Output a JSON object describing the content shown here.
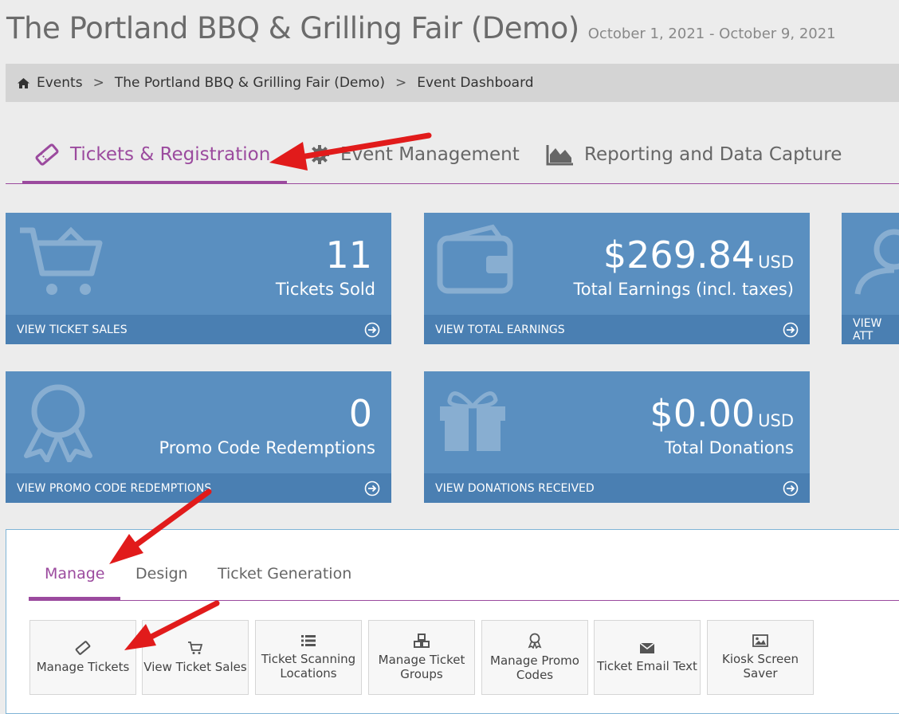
{
  "header": {
    "title": "The Portland BBQ & Grilling Fair (Demo)",
    "dates": "October 1, 2021 - October 9, 2021"
  },
  "breadcrumb": {
    "items": [
      "Events",
      "The Portland BBQ & Grilling Fair (Demo)",
      "Event Dashboard"
    ],
    "separator": ">"
  },
  "main_tabs": [
    {
      "label": "Tickets & Registration",
      "icon": "ticket-icon"
    },
    {
      "label": "Event Management",
      "icon": "gear-icon"
    },
    {
      "label": "Reporting and Data Capture",
      "icon": "area-chart-icon"
    }
  ],
  "cards": [
    {
      "value": "11",
      "unit": "",
      "label": "Tickets Sold",
      "footer": "VIEW TICKET SALES",
      "icon": "cart-icon"
    },
    {
      "value": "$269.84",
      "unit": "USD",
      "label": "Total Earnings (incl. taxes)",
      "footer": "VIEW TOTAL EARNINGS",
      "icon": "wallet-icon"
    },
    {
      "value": "",
      "unit": "",
      "label": "",
      "footer": "VIEW ATT",
      "icon": "user-icon"
    },
    {
      "value": "0",
      "unit": "",
      "label": "Promo Code Redemptions",
      "footer": "VIEW PROMO CODE REDEMPTIONS",
      "icon": "ribbon-icon"
    },
    {
      "value": "$0.00",
      "unit": "USD",
      "label": "Total Donations",
      "footer": "VIEW DONATIONS RECEIVED",
      "icon": "gift-icon"
    }
  ],
  "sub_tabs": [
    "Manage",
    "Design",
    "Ticket Generation"
  ],
  "tools": [
    {
      "label": "Manage Tickets",
      "icon": "ticket-icon"
    },
    {
      "label": "View Ticket Sales",
      "icon": "cart-icon"
    },
    {
      "label": "Ticket Scanning Locations",
      "icon": "list-icon"
    },
    {
      "label": "Manage Ticket Groups",
      "icon": "cubes-icon"
    },
    {
      "label": "Manage Promo Codes",
      "icon": "ribbon-icon"
    },
    {
      "label": "Ticket Email Text",
      "icon": "envelope-icon"
    },
    {
      "label": "Kiosk Screen Saver",
      "icon": "image-icon"
    }
  ],
  "colors": {
    "accent": "#9b4a9e",
    "card": "#5a8fc0",
    "card_footer": "#4a7fb2",
    "annotation_arrow": "#e11b1b"
  }
}
